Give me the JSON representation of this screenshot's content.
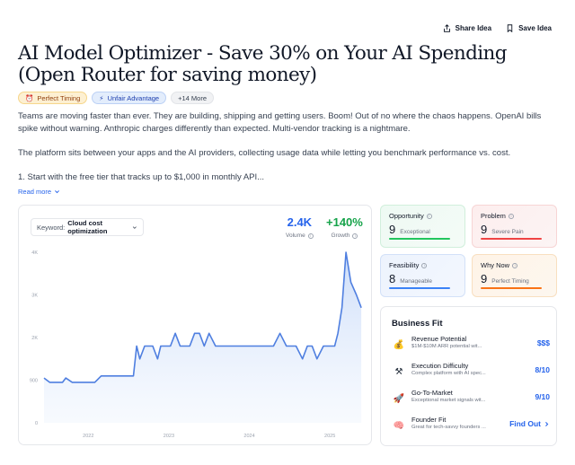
{
  "header": {
    "share_label": "Share Idea",
    "save_label": "Save Idea"
  },
  "title": "AI Model Optimizer - Save 30% on Your AI Spending (Open Router for saving money)",
  "badges": [
    {
      "icon": "alarm-clock-icon",
      "label": "Perfect Timing"
    },
    {
      "icon": "lightning-icon",
      "label": "Unfair Advantage"
    },
    {
      "label": "+14 More"
    }
  ],
  "description": {
    "p1": "Teams are moving faster than ever. They are building, shipping and getting users. Boom! Out of no where the chaos happens. OpenAI bills spike without warning. Anthropic charges differently than expected. Multi-vendor tracking is a nightmare.",
    "p2": "The platform sits between your apps and the AI providers, collecting usage data while letting you benchmark performance vs. cost.",
    "p3": "1. Start with the free tier that tracks up to $1,000 in monthly API...",
    "read_more": "Read more"
  },
  "keyword": {
    "label": "Keyword:",
    "value": "Cloud cost optimization"
  },
  "metrics": {
    "volume": {
      "value": "2.4K",
      "caption": "Volume"
    },
    "growth": {
      "value": "+140%",
      "caption": "Growth"
    }
  },
  "chart_data": {
    "type": "area",
    "title": "",
    "xlabel": "",
    "ylabel": "",
    "y_ticks": [
      "0",
      "900",
      "2K",
      "3K",
      "4K"
    ],
    "y_tick_values": [
      0,
      1000,
      2000,
      3000,
      4000
    ],
    "x_ticks": [
      "2022",
      "2023",
      "2024",
      "2025"
    ],
    "x_tick_values": [
      2022,
      2023,
      2024,
      2025
    ],
    "xlim": [
      2021.45,
      2025.4
    ],
    "ylim": [
      0,
      4000
    ],
    "grid": false,
    "series": [
      {
        "color": "#4f7fe0",
        "x": [
          2021.45,
          2021.52,
          2021.6,
          2021.68,
          2021.72,
          2021.8,
          2021.84,
          2021.92,
          2022.0,
          2022.08,
          2022.16,
          2022.24,
          2022.32,
          2022.4,
          2022.48,
          2022.56,
          2022.6,
          2022.64,
          2022.7,
          2022.74,
          2022.8,
          2022.86,
          2022.9,
          2022.96,
          2023.02,
          2023.08,
          2023.14,
          2023.2,
          2023.26,
          2023.32,
          2023.38,
          2023.44,
          2023.5,
          2023.58,
          2023.66,
          2023.74,
          2023.82,
          2023.9,
          2023.98,
          2024.06,
          2024.14,
          2024.22,
          2024.3,
          2024.38,
          2024.46,
          2024.52,
          2024.58,
          2024.66,
          2024.72,
          2024.78,
          2024.84,
          2024.92,
          2025.0,
          2025.06,
          2025.1,
          2025.15,
          2025.2,
          2025.26,
          2025.33,
          2025.39
        ],
        "y": [
          1050,
          950,
          950,
          950,
          1050,
          950,
          950,
          950,
          950,
          950,
          1100,
          1100,
          1100,
          1100,
          1100,
          1100,
          1800,
          1500,
          1800,
          1800,
          1800,
          1500,
          1800,
          1800,
          1800,
          2100,
          1800,
          1800,
          1800,
          2100,
          2100,
          1800,
          2100,
          1800,
          1800,
          1800,
          1800,
          1800,
          1800,
          1800,
          1800,
          1800,
          1800,
          2100,
          1800,
          1800,
          1800,
          1500,
          1800,
          1800,
          1500,
          1800,
          1800,
          1800,
          2100,
          2700,
          4000,
          3300,
          3000,
          2700
        ]
      }
    ]
  },
  "scores": {
    "opportunity": {
      "label": "Opportunity",
      "value": "9",
      "sub": "Exceptional"
    },
    "problem": {
      "label": "Problem",
      "value": "9",
      "sub": "Severe Pain"
    },
    "feasibility": {
      "label": "Feasibility",
      "value": "8",
      "sub": "Manageable"
    },
    "why_now": {
      "label": "Why Now",
      "value": "9",
      "sub": "Perfect Timing"
    }
  },
  "business_fit": {
    "title": "Business Fit",
    "items": [
      {
        "icon": "money-bag-icon",
        "title": "Revenue Potential",
        "sub": "$1M-$10M ARR potential wit...",
        "value": "$$$"
      },
      {
        "icon": "tools-icon",
        "title": "Execution Difficulty",
        "sub": "Complex platform with AI spec...",
        "value": "8/10"
      },
      {
        "icon": "rocket-icon",
        "title": "Go-To-Market",
        "sub": "Exceptional market signals wit...",
        "value": "9/10"
      },
      {
        "icon": "brain-icon",
        "title": "Founder Fit",
        "sub": "Great for tech-savvy founders ...",
        "value": "Find Out"
      }
    ]
  }
}
